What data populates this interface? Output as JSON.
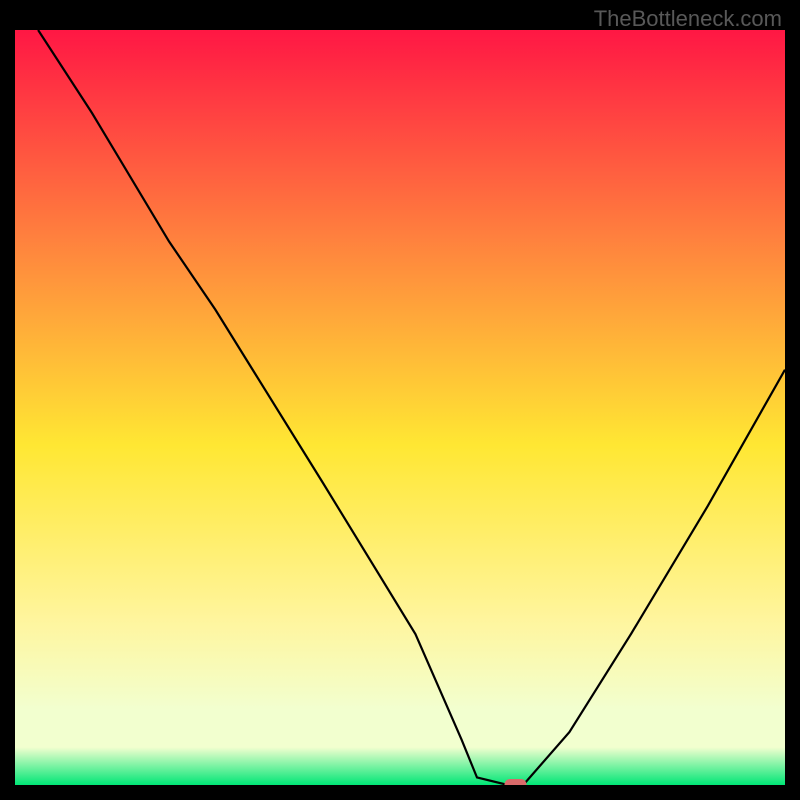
{
  "watermark": "TheBottleneck.com",
  "chart_data": {
    "type": "line",
    "title": "",
    "xlabel": "",
    "ylabel": "",
    "xlim": [
      0,
      100
    ],
    "ylim": [
      0,
      100
    ],
    "gradient_colors": {
      "top": "#ff1744",
      "mid_upper": "#ff8a3d",
      "mid": "#ffe733",
      "mid_lower": "#fff59d",
      "low": "#f2ffcf",
      "bottom": "#00e676"
    },
    "series": [
      {
        "name": "bottleneck-curve",
        "x": [
          3,
          10,
          20,
          26,
          40,
          52,
          58,
          60,
          64,
          66,
          72,
          80,
          90,
          100
        ],
        "y": [
          100,
          89,
          72,
          63,
          40,
          20,
          6,
          1,
          0,
          0,
          7,
          20,
          37,
          55
        ]
      }
    ],
    "markers": [
      {
        "name": "optimal-point",
        "x": 65,
        "y": 0,
        "color": "#d86a6a"
      }
    ]
  }
}
